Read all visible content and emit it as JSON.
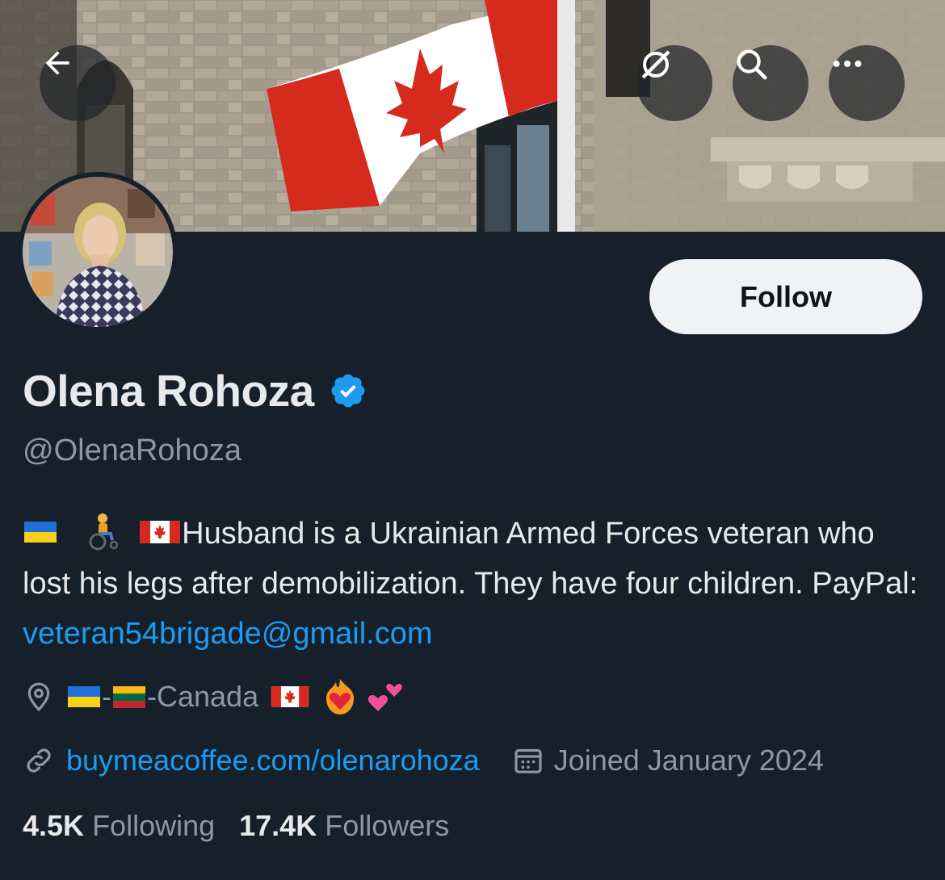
{
  "header": {
    "back_icon": "arrow-left-icon",
    "grok_icon": "grok-icon",
    "search_icon": "search-icon",
    "more_icon": "more-horizontal-icon"
  },
  "profile": {
    "display_name": "Olena Rohoza",
    "handle": "@OlenaRohoza",
    "verified_color": "#1d9bf0",
    "follow_label": "Follow",
    "bio_text": "Husband is a Ukrainian Armed Forces veteran who lost his legs after demobilization. They have four children. PayPal: ",
    "bio_email": "veteran54brigade@gmail.com",
    "location_dash1": " -",
    "location_text": "-Canada",
    "website": "buymeacoffee.com/olenarohoza",
    "joined": "Joined January 2024"
  },
  "stats": {
    "following_count": "4.5K",
    "following_label": "Following",
    "followers_count": "17.4K",
    "followers_label": "Followers"
  },
  "colors": {
    "background": "#15202b",
    "text_primary": "#e7e9ea",
    "text_secondary": "#8b98a5",
    "link": "#1d9bf0"
  }
}
